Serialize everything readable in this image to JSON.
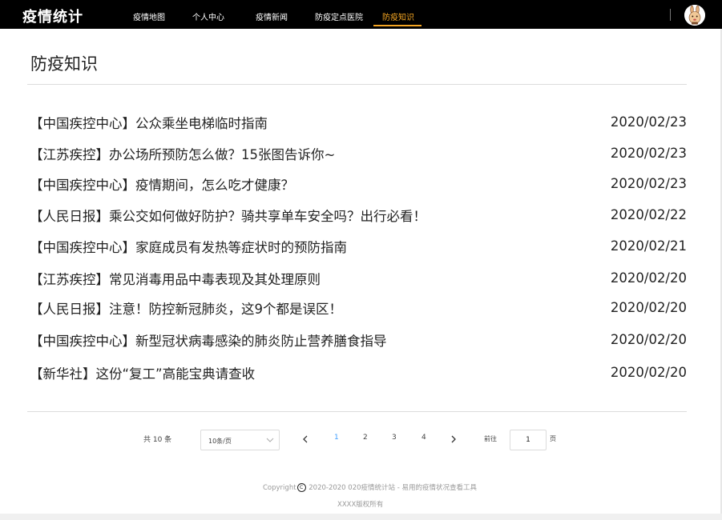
{
  "header": {
    "brand": "疫情统计",
    "nav": [
      "疫情地图",
      "个人中心",
      "疫情新闻",
      "防疫定点医院",
      "防疫知识"
    ],
    "active_nav": "防疫知识"
  },
  "page": {
    "title": "防疫知识"
  },
  "articles": [
    {
      "title": "【中国疾控中心】公众乘坐电梯临时指南",
      "date": "2020/02/23"
    },
    {
      "title": "【江苏疾控】办公场所预防怎么做？15张图告诉你~",
      "date": "2020/02/23"
    },
    {
      "title": "【中国疾控中心】疫情期间，怎么吃才健康？",
      "date": "2020/02/23"
    },
    {
      "title": "【人民日报】乘公交如何做好防护？骑共享单车安全吗？出行必看！",
      "date": "2020/02/22"
    },
    {
      "title": "【中国疾控中心】家庭成员有发热等症状时的预防指南",
      "date": "2020/02/21"
    },
    {
      "title": "【江苏疾控】常见消毒用品中毒表现及其处理原则",
      "date": "2020/02/20"
    },
    {
      "title": "【人民日报】注意！防控新冠肺炎，这9个都是误区！",
      "date": "2020/02/20"
    },
    {
      "title": "【中国疾控中心】新型冠状病毒感染的肺炎防止营养膳食指导",
      "date": "2020/02/20"
    },
    {
      "title": "【新华社】这份“复工”高能宝典请查收",
      "date": "2020/02/20"
    }
  ],
  "pagination": {
    "total_text": "共 10 条",
    "page_size": "10条/页",
    "pages": [
      "1",
      "2",
      "3",
      "4"
    ],
    "current_page": "1",
    "goto_label": "前往",
    "goto_value": "1",
    "page_unit": "页"
  },
  "footer": {
    "copyright_prefix": "Copyright",
    "copyright_symbol": "C",
    "copyright_text": "2020-2020 020疫情统计站 - 易用的疫情状况查看工具",
    "rights": "XXXX版权所有"
  },
  "colors": {
    "accent": "#f5a623",
    "link": "#409eff",
    "topbar": "#000000"
  },
  "icons": {
    "prev": "chevron-left-icon",
    "next": "chevron-right-icon",
    "dropdown": "chevron-down-icon",
    "avatar": "rabbit-avatar-icon"
  }
}
